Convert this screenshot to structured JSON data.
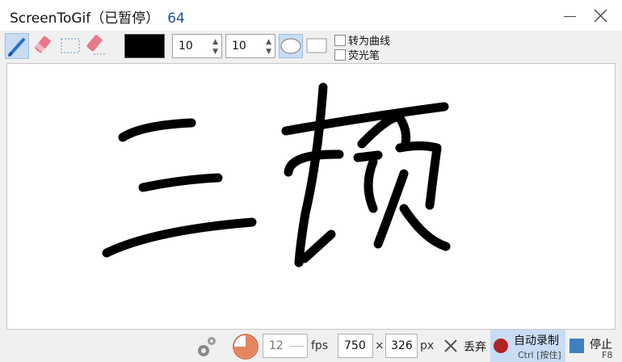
{
  "window": {
    "title": "ScreenToGif（已暂停）",
    "frame_count": "64"
  },
  "toolbar": {
    "tools": [
      "pen-tool",
      "eraser-tool",
      "select-tool",
      "erase-selection-tool"
    ],
    "selected_tool": "pen-tool",
    "color": "#000000",
    "width_value": "10",
    "height_value": "10",
    "shapes": [
      "ellipse",
      "rectangle"
    ],
    "selected_shape": "ellipse",
    "checkbox_curves": "转为曲线",
    "checkbox_highlighter": "荧光笔"
  },
  "canvas": {
    "drawn_text": "三顿"
  },
  "status": {
    "fps_value": "12",
    "fps_unit": "fps",
    "width_value": "750",
    "times": "×",
    "height_value": "326",
    "size_unit": "px",
    "discard_label": "丢弃",
    "record_label": "自动录制",
    "record_shortcut": "Ctrl [按住]",
    "stop_label": "停止",
    "stop_shortcut": "F8"
  }
}
